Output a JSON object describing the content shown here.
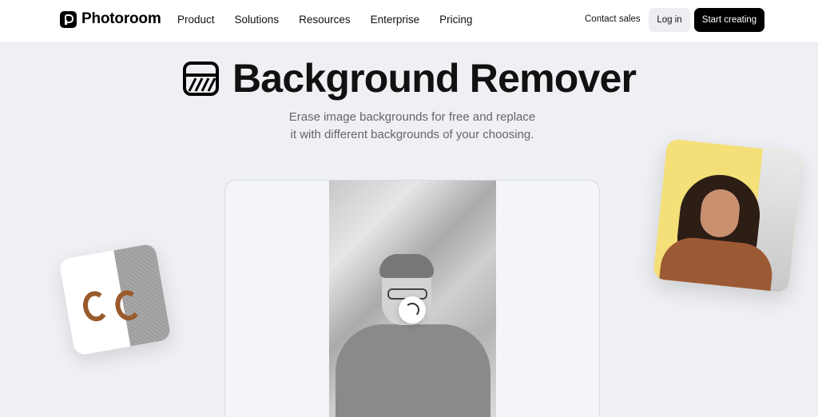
{
  "brand": {
    "name": "Photoroom"
  },
  "nav": {
    "items": [
      {
        "label": "Product"
      },
      {
        "label": "Solutions"
      },
      {
        "label": "Resources"
      },
      {
        "label": "Enterprise"
      },
      {
        "label": "Pricing"
      }
    ],
    "contact_label": "Contact sales",
    "login_label": "Log in",
    "start_label": "Start creating"
  },
  "hero": {
    "title": "Background Remover",
    "subtitle_line1": "Erase image backgrounds for free and replace",
    "subtitle_line2": "it with different backgrounds of your choosing."
  },
  "colors": {
    "accent": "#000000",
    "page_background": "#eef0f4",
    "card_yellow": "#f5df78"
  },
  "icons": {
    "title_icon": "eraser-frame-icon",
    "loading": "spinner-icon"
  }
}
